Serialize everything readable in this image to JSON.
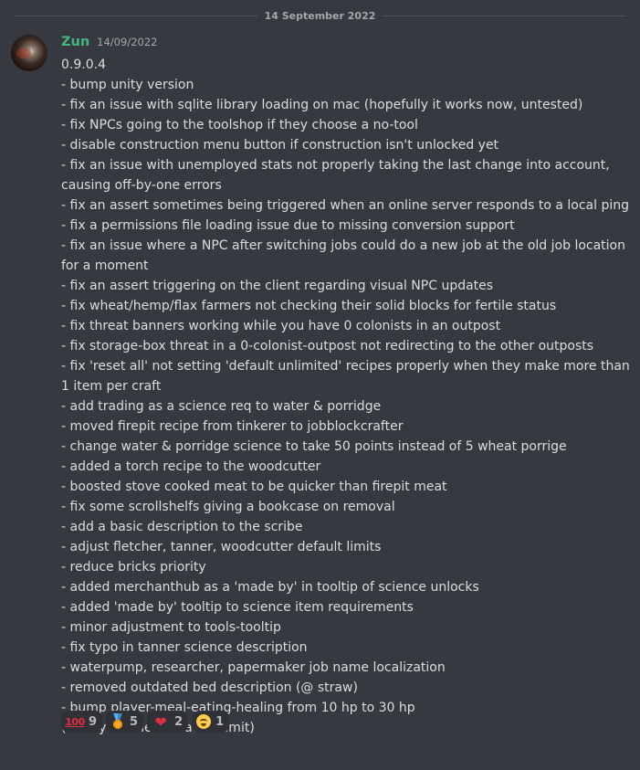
{
  "date_divider": "14 September 2022",
  "message": {
    "author": "Zun",
    "timestamp": "14/09/2022",
    "lines": [
      "0.9.0.4",
      "- bump unity version",
      "- fix an issue with sqlite library loading on mac (hopefully it works now, untested)",
      "- fix NPCs going to the toolshop if they choose a no-tool",
      "- disable construction menu button if construction isn't unlocked yet",
      "- fix an issue with unemployed stats not properly taking the last change into account,",
      "causing off-by-one errors",
      "- fix an assert sometimes being triggered when an online server responds to a local ping",
      "- fix a permissions file loading issue due to missing conversion support",
      "- fix an issue where a NPC after switching jobs could do a new job at the old job location",
      "for a moment",
      "- fix an assert triggering on the client regarding visual NPC updates",
      "- fix wheat/hemp/flax farmers not checking their solid blocks for fertile status",
      "- fix threat banners working while you have 0 colonists in an outpost",
      "- fix storage-box threat in a 0-colonist-outpost not redirecting to the other outposts",
      "- fix 'reset all' not setting 'default unlimited' recipes properly when they make more than",
      "1 item per craft",
      "- add trading as a science req to water & porridge",
      "- moved firepit recipe from tinkerer to jobblockcrafter",
      "- change water & porridge science to take 50 points instead of 5 wheat porrige",
      "- added a torch recipe to the woodcutter",
      "- boosted stove cooked meat to be quicker than firepit meat",
      "- fix some scrollshelfs giving a bookcase on removal",
      "- add a basic description to the scribe",
      "- adjust fletcher, tanner, woodcutter default limits",
      "- reduce bricks priority",
      "- added merchanthub as a 'made by' in tooltip of science unlocks",
      "- added 'made by' tooltip to science item requirements",
      "- minor adjustment to tools-tooltip",
      "- fix typo in tanner science description",
      "- waterpump, researcher, papermaker job name localization",
      "- removed outdated bed description (@ straw)",
      "- bump player-meal-eating-healing from 10 hp to 30 hp",
      "(nearly hit the character limit)"
    ]
  },
  "reactions": [
    {
      "icon": "hundred-points-icon",
      "glyph": "100",
      "count": "9"
    },
    {
      "icon": "medal-icon",
      "glyph": "",
      "count": "5"
    },
    {
      "icon": "heart-icon",
      "glyph": "❤",
      "count": "2"
    },
    {
      "icon": "grimacing-face-icon",
      "glyph": "",
      "count": "1"
    }
  ],
  "colors": {
    "background": "#36393f",
    "username": "#43b581",
    "text": "#dcddde",
    "muted": "#a3a6aa",
    "reaction_bg": "#2f3136"
  }
}
